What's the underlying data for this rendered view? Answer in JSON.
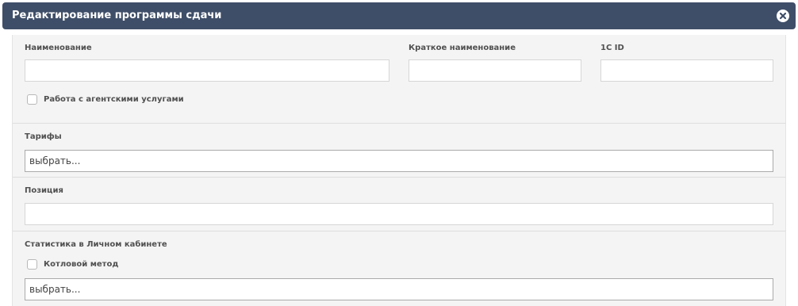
{
  "modal": {
    "title": "Редактирование программы сдачи",
    "close_icon": "close-circle-icon"
  },
  "form": {
    "name": {
      "label": "Наименование",
      "value": ""
    },
    "short_name": {
      "label": "Краткое наименование",
      "value": ""
    },
    "id_1c": {
      "label": "1C ID",
      "value": ""
    },
    "agent_services": {
      "label": "Работа с агентскими услугами",
      "checked": false
    },
    "tariffs": {
      "label": "Тарифы",
      "placeholder": "выбрать..."
    },
    "position": {
      "label": "Позиция",
      "value": ""
    },
    "statistics": {
      "label": "Статистика в Личном кабинете",
      "boiler_method": {
        "label": "Котловой метод",
        "checked": false
      },
      "placeholder": "выбрать..."
    }
  },
  "colors": {
    "header_bg": "#3f4e68",
    "body_bg": "#f4f4f4"
  }
}
